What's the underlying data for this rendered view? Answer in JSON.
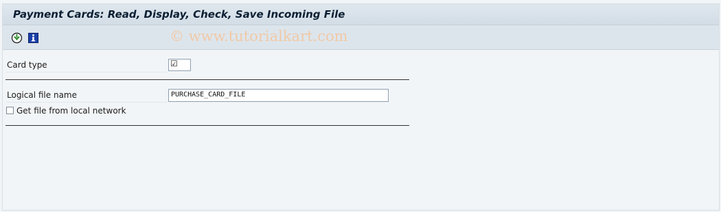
{
  "window": {
    "title": "Payment Cards: Read, Display, Check, Save Incoming File"
  },
  "toolbar": {
    "execute_icon": "execute-icon",
    "info_icon": "information-icon",
    "watermark": "© www.tutorialkart.com"
  },
  "form": {
    "card_type_label": "Card type",
    "card_type_value": "☑",
    "logical_file_label": "Logical file name",
    "logical_file_value": "PURCHASE_CARD_FILE",
    "local_network_label": "Get file from local network",
    "local_network_checked": false
  },
  "colors": {
    "title_bg": "#d3dde6",
    "toolbar_bg": "#dde5ec",
    "body_bg": "#f2f5f7",
    "watermark": "#f0c9a6",
    "info_icon_bg": "#1a3fa8"
  }
}
